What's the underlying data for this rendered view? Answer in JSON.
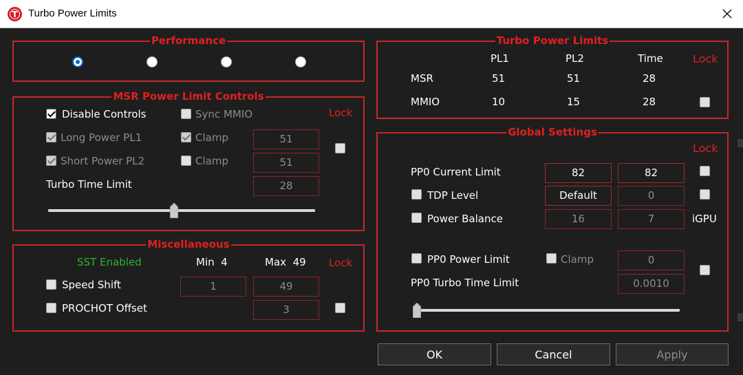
{
  "window": {
    "title": "Turbo Power Limits",
    "icon_letter": "T"
  },
  "performance": {
    "legend": "Performance",
    "selected_index": 0,
    "options_count": 4
  },
  "msr": {
    "legend": "MSR Power Limit Controls",
    "disable_controls": {
      "label": "Disable Controls",
      "checked": true
    },
    "sync_mmio": {
      "label": "Sync MMIO",
      "checked": false
    },
    "lock_label": "Lock",
    "long_power": {
      "label": "Long Power PL1",
      "checked": true,
      "clamp_label": "Clamp",
      "clamp_checked": true,
      "value": "51"
    },
    "short_power": {
      "label": "Short Power PL2",
      "checked": true,
      "clamp_label": "Clamp",
      "clamp_checked": false,
      "value": "51"
    },
    "turbo_time": {
      "label": "Turbo Time Limit",
      "value": "28"
    },
    "slider_level": 0.47
  },
  "misc": {
    "legend": "Miscellaneous",
    "sst_status": "SST Enabled",
    "min_label": "Min",
    "min_value": "4",
    "max_label": "Max",
    "max_value": "49",
    "lock_label": "Lock",
    "speed_shift": {
      "label": "Speed Shift",
      "checked": false,
      "min_field": "1",
      "max_field": "49"
    },
    "prochot": {
      "label": "PROCHOT Offset",
      "checked": false,
      "value": "3"
    }
  },
  "turbo_limits": {
    "legend": "Turbo Power Limits",
    "headers": [
      "PL1",
      "PL2",
      "Time"
    ],
    "lock_label": "Lock",
    "rows": [
      {
        "name": "MSR",
        "values": [
          "51",
          "51",
          "28"
        ]
      },
      {
        "name": "MMIO",
        "values": [
          "10",
          "15",
          "28"
        ]
      }
    ]
  },
  "global": {
    "legend": "Global Settings",
    "lock_label": "Lock",
    "pp0_current": {
      "label": "PP0 Current Limit",
      "value1": "82",
      "value2": "82"
    },
    "tdp_level": {
      "label": "TDP Level",
      "checked": false,
      "value1": "Default",
      "value2": "0"
    },
    "power_balance": {
      "label": "Power Balance",
      "checked": false,
      "value1": "16",
      "value2": "7",
      "suffix": "iGPU"
    },
    "pp0_power_limit": {
      "label": "PP0 Power Limit",
      "checked": false,
      "clamp_label": "Clamp",
      "value": "0"
    },
    "pp0_turbo_time": {
      "label": "PP0 Turbo Time Limit",
      "value": "0.0010"
    },
    "slider_level": 0.0
  },
  "buttons": {
    "ok": "OK",
    "cancel": "Cancel",
    "apply": "Apply"
  },
  "colors": {
    "accent_red": "#c42929",
    "legend_red": "#e02020",
    "status_green": "#2cb52c",
    "radio_blue": "#0a64c8"
  },
  "icons": [
    "app-logo-icon",
    "close-icon",
    "slider-thumb-icon"
  ]
}
